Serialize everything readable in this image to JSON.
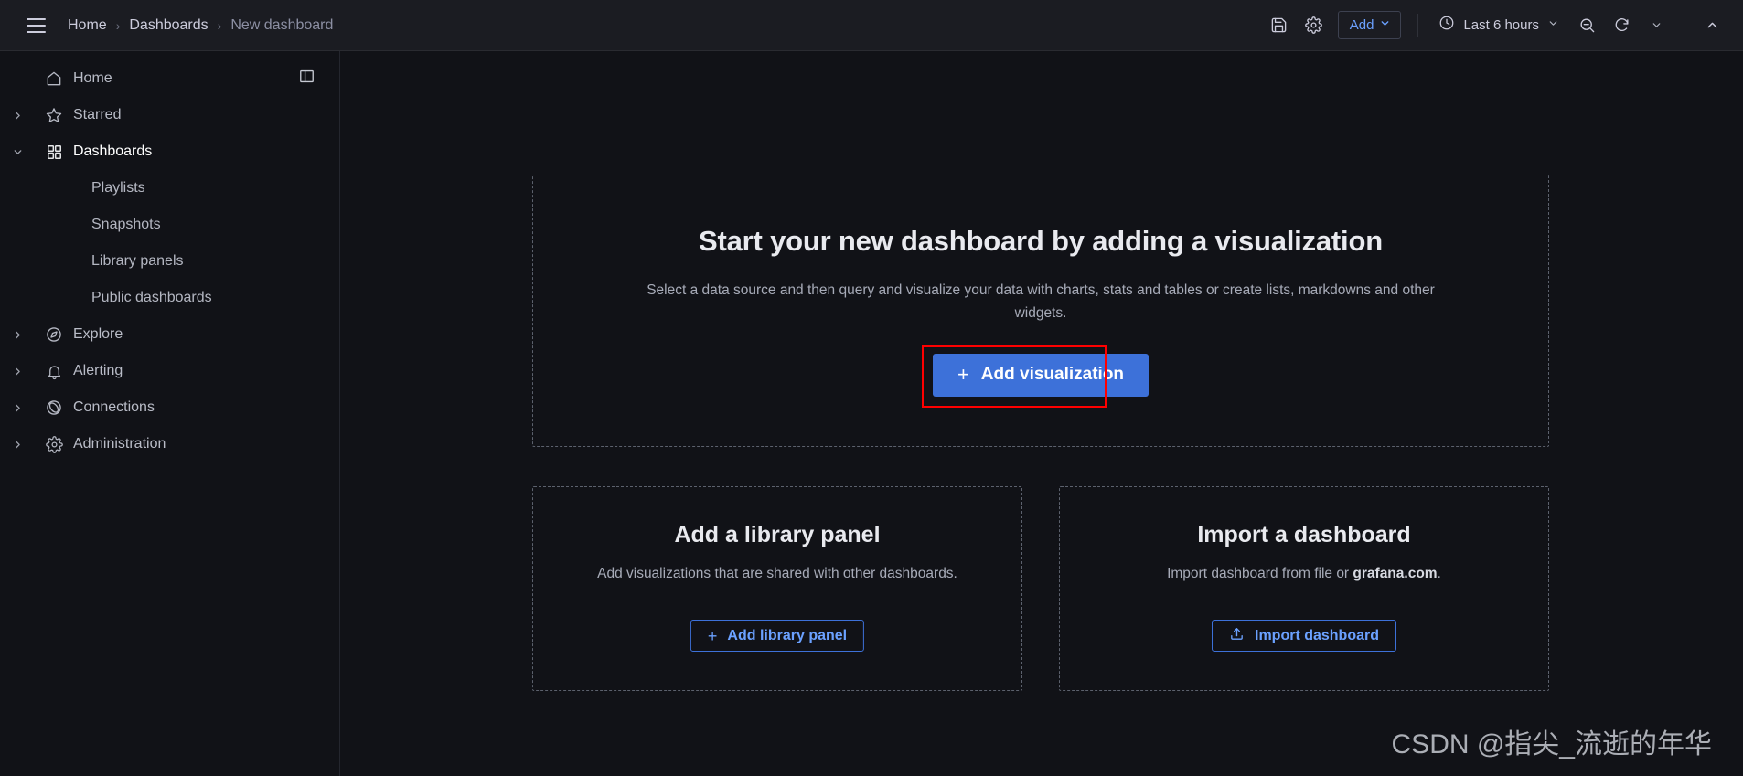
{
  "header": {
    "menu_icon": "hamburger-icon",
    "breadcrumbs": [
      {
        "label": "Home",
        "current": false
      },
      {
        "label": "Dashboards",
        "current": false
      },
      {
        "label": "New dashboard",
        "current": true
      }
    ],
    "separator": "›",
    "save_icon": "save-disk-icon",
    "settings_icon": "gear-icon",
    "add_label": "Add",
    "add_chevron": "chevron-down-icon",
    "time_icon": "clock-icon",
    "time_range": "Last 6 hours",
    "time_chevron": "chevron-down-icon",
    "zoom_out_icon": "zoom-out-icon",
    "refresh_icon": "refresh-icon",
    "refresh_chevron": "chevron-down-icon",
    "collapse_icon": "chevron-up-icon"
  },
  "sidebar": {
    "dock_icon": "dock-menu-icon",
    "items": [
      {
        "label": "Home",
        "icon": "home-icon",
        "expandable": false,
        "expanded": false,
        "active": false,
        "child": false
      },
      {
        "label": "Starred",
        "icon": "star-icon",
        "expandable": true,
        "expanded": false,
        "active": false,
        "child": false
      },
      {
        "label": "Dashboards",
        "icon": "dashboards-grid-icon",
        "expandable": true,
        "expanded": true,
        "active": true,
        "child": false
      },
      {
        "label": "Playlists",
        "icon": "",
        "expandable": false,
        "expanded": false,
        "active": false,
        "child": true
      },
      {
        "label": "Snapshots",
        "icon": "",
        "expandable": false,
        "expanded": false,
        "active": false,
        "child": true
      },
      {
        "label": "Library panels",
        "icon": "",
        "expandable": false,
        "expanded": false,
        "active": false,
        "child": true
      },
      {
        "label": "Public dashboards",
        "icon": "",
        "expandable": false,
        "expanded": false,
        "active": false,
        "child": true
      },
      {
        "label": "Explore",
        "icon": "compass-icon",
        "expandable": true,
        "expanded": false,
        "active": false,
        "child": false
      },
      {
        "label": "Alerting",
        "icon": "bell-icon",
        "expandable": true,
        "expanded": false,
        "active": false,
        "child": false
      },
      {
        "label": "Connections",
        "icon": "connections-icon",
        "expandable": true,
        "expanded": false,
        "active": false,
        "child": false
      },
      {
        "label": "Administration",
        "icon": "gear-icon",
        "expandable": true,
        "expanded": false,
        "active": false,
        "child": false
      }
    ]
  },
  "main": {
    "hero": {
      "title": "Start your new dashboard by adding a visualization",
      "subtitle": "Select a data source and then query and visualize your data with charts, stats and tables or create lists, markdowns and other widgets.",
      "button_label": "Add visualization",
      "button_plus": "+",
      "highlight_color": "#ff0000"
    },
    "library_card": {
      "title": "Add a library panel",
      "subtitle": "Add visualizations that are shared with other dashboards.",
      "button_label": "Add library panel",
      "button_plus": "+"
    },
    "import_card": {
      "title": "Import a dashboard",
      "subtitle_before": "Import dashboard from file or ",
      "subtitle_link": "grafana.com",
      "subtitle_after": ".",
      "button_label": "Import dashboard",
      "button_icon": "upload-icon"
    }
  },
  "watermark": {
    "text": "CSDN @指尖_流逝的年华"
  },
  "colors": {
    "accent_blue": "#3d71d9",
    "link_blue": "#6ba1ff",
    "annotation_red": "#ff0000",
    "background": "#111217",
    "header_background": "#1b1c22"
  }
}
